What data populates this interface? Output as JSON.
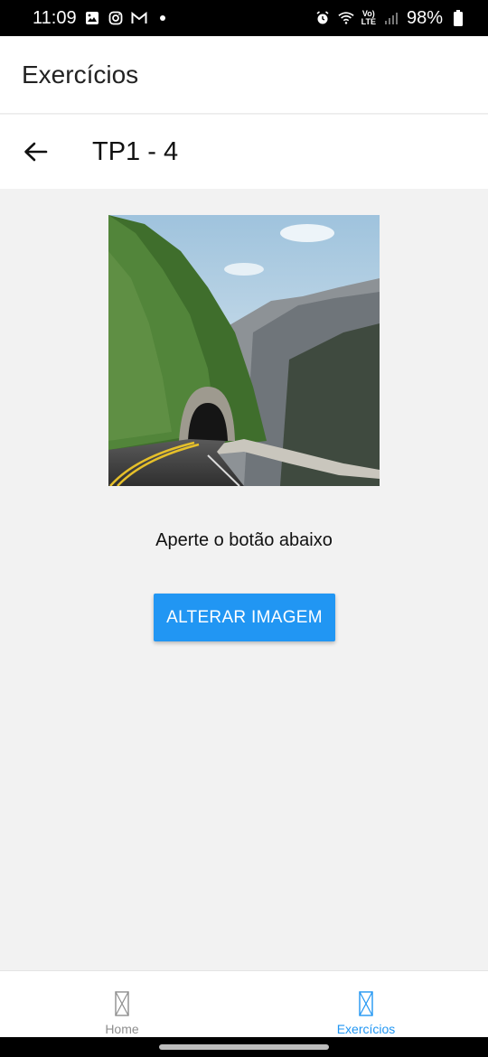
{
  "status_bar": {
    "time": "11:09",
    "lte_top": "Vo)",
    "lte_bottom": "LTE",
    "battery": "98%"
  },
  "app_bar": {
    "title": "Exercícios"
  },
  "header": {
    "title": "TP1 - 4"
  },
  "main": {
    "caption": "Aperte o botão abaixo",
    "button_label": "ALTERAR IMAGEM"
  },
  "bottom_nav": {
    "tabs": [
      {
        "label": "Home",
        "active": false
      },
      {
        "label": "Exercícios",
        "active": true
      }
    ]
  },
  "colors": {
    "accent": "#2196f3",
    "background": "#f2f2f2",
    "inactive_tab": "#8e8e8e"
  }
}
